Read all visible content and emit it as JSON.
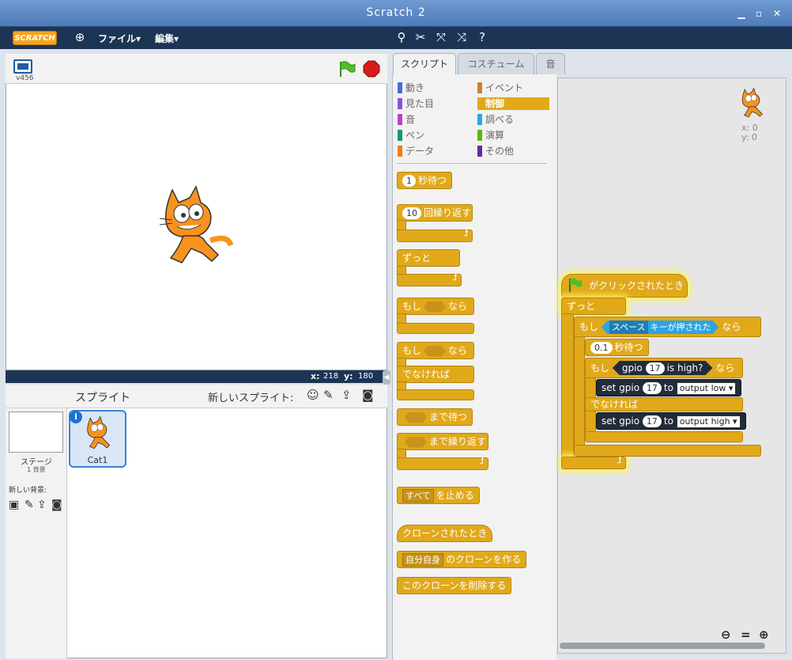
{
  "window": {
    "title": "Scratch 2"
  },
  "menubar": {
    "logo": "SCRATCH",
    "file": "ファイル▾",
    "edit": "編集▾"
  },
  "stage": {
    "version": "v456",
    "x_label": "x:",
    "x_value": "218",
    "y_label": "y:",
    "y_value": "180"
  },
  "sprites": {
    "title": "スプライト",
    "new_sprite": "新しいスプライト:",
    "stage_label": "ステージ",
    "stage_backdrops": "1 背景",
    "new_backdrop": "新しい背景:",
    "sprite_name": "Cat1"
  },
  "tabs": [
    "スクリプト",
    "コスチューム",
    "音"
  ],
  "categories": [
    {
      "label": "動き",
      "color": "#4a6cd4"
    },
    {
      "label": "イベント",
      "color": "#c88330"
    },
    {
      "label": "見た目",
      "color": "#8a55d7"
    },
    {
      "label": "制御",
      "color": "#e1a91a"
    },
    {
      "label": "音",
      "color": "#bb42c3"
    },
    {
      "label": "調べる",
      "color": "#2ca5e2"
    },
    {
      "label": "ペン",
      "color": "#0e9a6c"
    },
    {
      "label": "演算",
      "color": "#5cb712"
    },
    {
      "label": "データ",
      "color": "#ee7d16"
    },
    {
      "label": "その他",
      "color": "#632d99"
    }
  ],
  "palette": {
    "wait_num": "1",
    "wait_label": "秒待つ",
    "repeat_num": "10",
    "repeat_label": "回繰り返す",
    "forever": "ずっと",
    "if": "もし",
    "then": "なら",
    "if2": "もし",
    "then2": "なら",
    "else": "でなければ",
    "wait_until": "まで待つ",
    "repeat_until": "まで繰り返す",
    "stop_opt": "すべて",
    "stop_label": "を止める",
    "clone_start": "クローンされたとき",
    "clone_opt": "自分自身",
    "clone_label": "のクローンを作る",
    "delete_clone": "このクローンを削除する"
  },
  "script": {
    "sprite_x": "x: 0",
    "sprite_y": "y: 0",
    "hat": "がクリックされたとき",
    "forever": "ずっと",
    "if": "もし",
    "key_opt": "スペース",
    "key_label": "キーが押された",
    "then": "なら",
    "wait_num": "0.1",
    "wait_label": "秒待つ",
    "if2": "もし",
    "gpio_label": "gpio",
    "gpio_pin": "17",
    "is_high": "is high?",
    "then2": "なら",
    "set1": "set",
    "set1_gpio": "gpio",
    "set1_pin": "17",
    "set1_to": "to",
    "set1_opt": "output low",
    "else": "でなければ",
    "set2": "set",
    "set2_gpio": "gpio",
    "set2_pin": "17",
    "set2_to": "to",
    "set2_opt": "output high"
  }
}
